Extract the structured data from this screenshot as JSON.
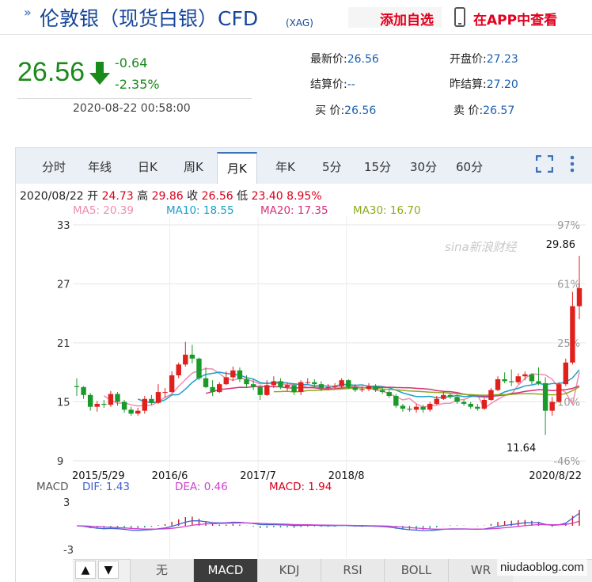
{
  "header": {
    "title": "伦敦银（现货白银）CFD",
    "title_sub": "(XAG)",
    "watch_label": "添加自选",
    "app_label": "在APP中查看"
  },
  "quote": {
    "price": "26.56",
    "change": "-0.64",
    "change_pct": "-2.35%",
    "time": "2020-08-22 00:58:00",
    "latest_label": "最新价:",
    "latest": "26.56",
    "open_label": "开盘价:",
    "open": "27.23",
    "settle_label": "结算价:",
    "settle": "--",
    "prev_settle_label": "昨结算:",
    "prev_settle": "27.20",
    "buy_label": "买  价:",
    "buy": "26.56",
    "sell_label": "卖  价:",
    "sell": "26.57"
  },
  "tabs": [
    {
      "label": "分时"
    },
    {
      "label": "年线"
    },
    {
      "label": "日K"
    },
    {
      "label": "周K"
    },
    {
      "label": "月K"
    },
    {
      "label": "年K"
    },
    {
      "label": "5分"
    },
    {
      "label": "15分"
    },
    {
      "label": "30分"
    },
    {
      "label": "60分"
    }
  ],
  "active_tab": "月K",
  "bar_info": {
    "date": "2020/08/22",
    "open_label": "开",
    "open": "24.73",
    "high_label": "高",
    "high": "29.86",
    "close_label": "收",
    "close": "26.56",
    "low_label": "低",
    "low": "23.40",
    "pct": "8.95%"
  },
  "ma_legend": [
    {
      "text": "MA5: 20.39",
      "color": "#f08cb0"
    },
    {
      "text": "MA10: 18.55",
      "color": "#1aa0c8"
    },
    {
      "text": "MA20: 17.35",
      "color": "#d8307a"
    },
    {
      "text": "MA30: 16.70",
      "color": "#8caa1e"
    }
  ],
  "macd_legend": {
    "label": "MACD",
    "dif": "DIF: 1.43",
    "dea": "DEA: 0.46",
    "macd": "MACD: 1.94"
  },
  "bottom_tabs": [
    {
      "label": "无"
    },
    {
      "label": "MACD"
    },
    {
      "label": "KDJ"
    },
    {
      "label": "RSI"
    },
    {
      "label": "BOLL"
    },
    {
      "label": "WR"
    }
  ],
  "active_bottom_tab": "MACD",
  "nav_up": "▲",
  "nav_down": "▼",
  "watermark": "niudaoblog.com",
  "chart_logo": "sina新浪财经",
  "colors": {
    "up": "#e0201c",
    "down": "#1a9a2a",
    "brand": "#16469a"
  },
  "chart_data": {
    "type": "candlestick",
    "interval": "monthly",
    "price_axis": {
      "ticks": [
        33,
        27,
        21,
        15,
        9
      ],
      "ylim": [
        9,
        33
      ]
    },
    "pct_axis": {
      "ticks": [
        "97%",
        "61%",
        "25%",
        "-10%",
        "-46%"
      ]
    },
    "x_ticks": [
      "2015/5/29",
      "2016/6",
      "2017/7",
      "2018/8",
      "2020/8/22"
    ],
    "annotations": [
      {
        "label": "29.86",
        "kind": "high"
      },
      {
        "label": "11.64",
        "kind": "low"
      }
    ],
    "candles": [
      [
        16.6,
        16.5,
        17.4,
        15.6
      ],
      [
        16.5,
        15.7,
        16.6,
        15.3
      ],
      [
        15.7,
        14.5,
        15.9,
        14.1
      ],
      [
        14.5,
        14.8,
        15.1,
        14.0
      ],
      [
        14.8,
        14.7,
        15.2,
        14.4
      ],
      [
        14.7,
        15.8,
        16.1,
        14.5
      ],
      [
        15.8,
        15.0,
        16.0,
        14.6
      ],
      [
        15.0,
        14.2,
        15.2,
        13.9
      ],
      [
        14.2,
        13.8,
        14.5,
        13.6
      ],
      [
        13.8,
        14.1,
        14.4,
        13.6
      ],
      [
        14.1,
        15.3,
        15.6,
        13.8
      ],
      [
        15.3,
        14.9,
        15.7,
        14.7
      ],
      [
        14.9,
        16.0,
        16.8,
        14.8
      ],
      [
        16.0,
        16.0,
        16.4,
        15.4
      ],
      [
        16.0,
        17.7,
        18.1,
        15.9
      ],
      [
        17.7,
        18.8,
        19.0,
        17.4
      ],
      [
        18.8,
        19.8,
        21.1,
        18.6
      ],
      [
        19.8,
        19.4,
        20.8,
        18.9
      ],
      [
        19.4,
        17.4,
        19.5,
        17.2
      ],
      [
        17.4,
        16.5,
        18.5,
        16.4
      ],
      [
        16.5,
        16.0,
        17.2,
        15.6
      ],
      [
        16.0,
        16.8,
        17.0,
        15.9
      ],
      [
        16.8,
        17.5,
        18.1,
        16.7
      ],
      [
        17.5,
        18.2,
        18.6,
        17.1
      ],
      [
        18.2,
        17.3,
        18.5,
        17.0
      ],
      [
        17.3,
        16.8,
        17.7,
        16.4
      ],
      [
        16.8,
        16.5,
        17.3,
        16.2
      ],
      [
        16.5,
        15.7,
        16.7,
        15.2
      ],
      [
        15.7,
        16.7,
        17.2,
        15.6
      ],
      [
        16.7,
        17.1,
        17.6,
        16.4
      ],
      [
        17.1,
        16.5,
        17.4,
        16.3
      ],
      [
        16.5,
        16.7,
        17.0,
        16.1
      ],
      [
        16.7,
        16.0,
        16.9,
        15.7
      ],
      [
        16.0,
        17.0,
        17.2,
        15.7
      ],
      [
        17.0,
        17.0,
        17.4,
        16.8
      ],
      [
        17.0,
        16.8,
        17.3,
        16.4
      ],
      [
        16.8,
        16.4,
        17.1,
        16.1
      ],
      [
        16.4,
        16.5,
        16.8,
        16.2
      ],
      [
        16.5,
        16.6,
        16.9,
        16.3
      ],
      [
        16.6,
        17.2,
        17.4,
        16.4
      ],
      [
        17.2,
        16.5,
        17.3,
        16.3
      ],
      [
        16.5,
        16.2,
        16.8,
        16.0
      ],
      [
        16.2,
        16.3,
        16.6,
        16.0
      ],
      [
        16.3,
        16.6,
        16.9,
        16.1
      ],
      [
        16.6,
        16.2,
        16.8,
        16.0
      ],
      [
        16.2,
        16.0,
        16.5,
        15.8
      ],
      [
        16.0,
        15.6,
        16.2,
        15.4
      ],
      [
        15.6,
        14.6,
        15.8,
        14.4
      ],
      [
        14.6,
        14.3,
        14.8,
        14.0
      ],
      [
        14.3,
        14.2,
        14.6,
        14.0
      ],
      [
        14.2,
        14.5,
        14.8,
        13.9
      ],
      [
        14.5,
        14.2,
        14.7,
        13.9
      ],
      [
        14.2,
        14.8,
        15.0,
        14.0
      ],
      [
        14.8,
        15.3,
        15.6,
        14.7
      ],
      [
        15.3,
        15.7,
        16.0,
        15.2
      ],
      [
        15.7,
        15.5,
        15.9,
        15.3
      ],
      [
        15.5,
        15.0,
        15.7,
        14.8
      ],
      [
        15.0,
        14.8,
        15.2,
        14.6
      ],
      [
        14.8,
        14.5,
        15.0,
        14.3
      ],
      [
        14.5,
        14.3,
        14.8,
        14.1
      ],
      [
        14.3,
        15.2,
        15.4,
        14.2
      ],
      [
        15.2,
        16.2,
        16.4,
        15.1
      ],
      [
        16.2,
        17.3,
        17.6,
        16.1
      ],
      [
        17.3,
        17.1,
        18.0,
        16.9
      ],
      [
        17.1,
        17.0,
        18.3,
        16.6
      ],
      [
        17.0,
        17.6,
        17.9,
        16.8
      ],
      [
        17.6,
        17.8,
        18.1,
        17.2
      ],
      [
        17.8,
        17.1,
        17.9,
        16.8
      ],
      [
        17.1,
        16.9,
        18.5,
        16.7
      ],
      [
        16.9,
        14.1,
        17.5,
        11.64
      ],
      [
        14.1,
        15.0,
        15.5,
        13.6
      ],
      [
        15.0,
        16.8,
        17.0,
        14.9
      ],
      [
        16.8,
        19.0,
        19.4,
        16.6
      ],
      [
        19.0,
        24.73,
        26.2,
        18.8
      ],
      [
        24.73,
        26.56,
        29.86,
        23.4
      ]
    ],
    "ma_series": [
      {
        "name": "MA5",
        "values": [
          null,
          null,
          null,
          null,
          15.62,
          15.16,
          14.86,
          14.9,
          14.7,
          14.58,
          14.64,
          14.66,
          15.02,
          15.46,
          15.8,
          16.58,
          17.26,
          17.92,
          18.18,
          18.38,
          18.34,
          17.88,
          17.36,
          17.2,
          17.4,
          17.32,
          17.06,
          16.84,
          16.9,
          16.88,
          16.9,
          16.7,
          16.8,
          16.74,
          16.46,
          16.56,
          16.44,
          16.34,
          16.48,
          16.54,
          16.64,
          16.56,
          16.48,
          16.38,
          16.2,
          16.08,
          15.86,
          15.52,
          15.2,
          15.34,
          14.8,
          14.48,
          14.58,
          14.68,
          14.84,
          14.86,
          15.18,
          15.24,
          15.5,
          15.72,
          14.32,
          14.84,
          15.26,
          15.64,
          15.78,
          16.68,
          17.38,
          17.86,
          17.8,
          17.74,
          17.3,
          16.42,
          15.96,
          14.74,
          18.04
        ]
      },
      {
        "name": "MA10",
        "values": [
          null,
          null,
          null,
          null,
          null,
          null,
          null,
          null,
          null,
          15.28,
          15.04,
          14.92,
          14.98,
          15.2,
          15.7,
          15.73,
          16.3,
          16.97,
          17.47,
          17.79,
          17.9,
          18.02,
          17.89,
          17.8,
          17.72,
          17.47,
          17.32,
          16.96,
          16.88,
          16.95,
          17.03,
          16.9,
          16.83,
          16.77,
          16.75,
          16.64,
          16.61,
          16.61,
          16.58,
          16.79,
          16.75,
          16.68,
          16.73,
          16.59,
          16.6,
          16.56,
          16.43,
          16.19,
          15.91,
          15.72,
          15.54,
          15.53,
          15.56,
          15.41,
          15.47,
          15.53,
          15.65,
          15.53,
          15.58,
          15.53,
          15.48,
          15.46,
          15.69,
          16.01,
          16.21,
          16.37,
          16.63,
          16.72,
          16.88,
          16.74,
          16.86,
          16.87,
          16.99,
          17.45,
          18.26
        ]
      },
      {
        "name": "MA20",
        "values": [
          null,
          null,
          null,
          null,
          null,
          null,
          null,
          null,
          null,
          null,
          null,
          null,
          null,
          null,
          null,
          null,
          null,
          null,
          null,
          15.86,
          16.04,
          16.26,
          16.32,
          16.4,
          16.48,
          16.47,
          16.54,
          16.58,
          16.55,
          16.55,
          16.52,
          16.42,
          16.41,
          16.44,
          16.45,
          16.43,
          16.33,
          16.31,
          16.32,
          16.41,
          16.43,
          16.48,
          16.44,
          16.44,
          16.47,
          16.47,
          16.49,
          16.46,
          16.44,
          16.43,
          16.38,
          16.34,
          16.28,
          16.15,
          16.07,
          16.04,
          15.95,
          15.78,
          15.68,
          15.62,
          15.57,
          15.57,
          15.63,
          15.71,
          15.85,
          15.93,
          16.06,
          16.14,
          16.24,
          16.21,
          16.14,
          16.18,
          16.24,
          16.37,
          16.63
        ]
      },
      {
        "name": "MA30",
        "values": [
          null,
          null,
          null,
          null,
          null,
          null,
          null,
          null,
          null,
          null,
          null,
          null,
          null,
          null,
          null,
          null,
          null,
          null,
          null,
          null,
          null,
          null,
          null,
          null,
          null,
          null,
          null,
          null,
          null,
          16.04,
          16.05,
          16.08,
          16.01,
          16.06,
          16.14,
          16.17,
          16.21,
          16.23,
          16.27,
          16.31,
          16.36,
          16.4,
          16.43,
          16.42,
          16.4,
          16.3,
          16.28,
          16.23,
          16.17,
          16.11,
          16.08,
          16.04,
          15.99,
          15.96,
          15.95,
          15.88,
          15.82,
          15.76,
          15.73,
          15.69,
          15.68,
          15.7,
          15.73,
          15.75,
          15.76,
          15.81,
          15.83,
          15.82,
          15.8,
          15.75,
          15.72,
          15.73,
          15.84,
          16.14,
          16.52
        ]
      }
    ],
    "macd_axis": {
      "ticks": [
        3,
        -3
      ],
      "ylim": [
        -3,
        3
      ]
    }
  }
}
